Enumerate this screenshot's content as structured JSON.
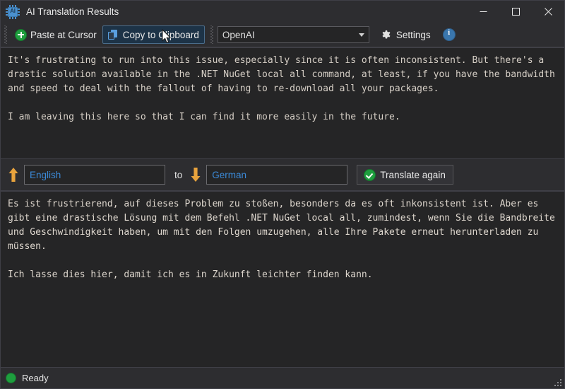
{
  "window": {
    "title": "AI Translation Results",
    "app_icon": "ai-chip-icon",
    "controls": {
      "minimize": "minimize-icon",
      "maximize": "maximize-icon",
      "close": "close-icon"
    }
  },
  "toolbar": {
    "paste_label": "Paste at Cursor",
    "paste_icon": "plus-circle-icon",
    "copy_label": "Copy to Clipboard",
    "copy_icon": "copy-icon",
    "copy_state": "hovered",
    "provider_value": "OpenAI",
    "provider_options": [
      "OpenAI"
    ],
    "settings_label": "Settings",
    "settings_icon": "gear-icon",
    "info_icon": "info-circle-icon"
  },
  "source": {
    "paragraph1": "It's frustrating to run into this issue, especially since it is often inconsistent. But there's a drastic solution available in the .NET NuGet local all command, at least, if you have the bandwidth and speed to deal with the fallout of having to re-download all your packages.",
    "paragraph2": "I am leaving this here so that I can find it more easily in the future."
  },
  "languages": {
    "source_icon": "arrow-up-icon",
    "source_value": "English",
    "to_label": "to",
    "target_icon": "arrow-down-icon",
    "target_value": "German",
    "translate_label": "Translate again",
    "translate_icon": "check-circle-icon"
  },
  "result": {
    "paragraph1": "Es ist frustrierend, auf dieses Problem zu stoßen, besonders da es oft inkonsistent ist. Aber es gibt eine drastische Lösung mit dem Befehl .NET NuGet local all, zumindest, wenn Sie die Bandbreite und Geschwindigkeit haben, um mit den Folgen umzugehen, alle Ihre Pakete erneut herunterladen zu müssen.",
    "paragraph2": "Ich lasse dies hier, damit ich es in Zukunft leichter finden kann."
  },
  "status": {
    "indicator": "status-dot-green",
    "text": "Ready",
    "resize_grip": "resize-grip-icon"
  },
  "colors": {
    "window_bg": "#2d2d30",
    "panel_bg": "#252526",
    "border": "#3f3f46",
    "text": "#e8e8e8",
    "mono_text": "#d6cfc6",
    "accent_blue": "#3b8ad8",
    "accent_orange": "#e8a33d",
    "accent_green": "#1e9e3e",
    "hover_bg": "#1d3347"
  }
}
